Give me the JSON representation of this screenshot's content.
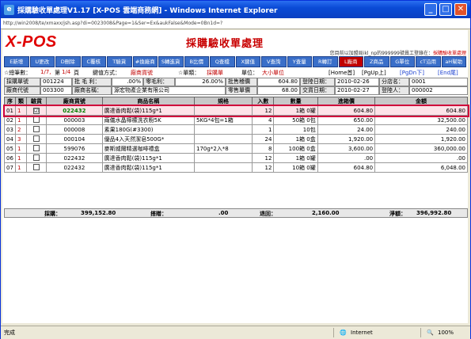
{
  "window": {
    "title": "採購驗收單處理V1.17 [X-POS 雲端商務網] - Windows Internet Explorer",
    "address": "http://win2008/te/xmaxx/jsh.asp?di=0023008&Page=1&Ser=Ex&aukFalse&Mode=0Bn1d=?"
  },
  "app": {
    "logo": "X-POS",
    "page_title": "採購驗收單處理"
  },
  "login": {
    "prefix": "您目前以加盟局ikl_np的999999號員工登錄在：",
    "page": "採購驗收單處理"
  },
  "toolbar": [
    "E新增",
    "U更改",
    "D刪除",
    "C覆核",
    "T驗貨",
    "#換廠商",
    "S轉進貨",
    "B比價",
    "Q查檔",
    "X鍵值",
    "V查詢",
    "Y查量",
    "R轉訂",
    "L廠商",
    "Z商品",
    "G單位",
    "cT沿用",
    "aH幫助"
  ],
  "summary": {
    "total_label": "☆總筆數：",
    "total_value": "1/7,",
    "page_label": "第",
    "page_value": "1/4",
    "page_suffix": "頁",
    "key_label": "鍵值方式：",
    "key_value": "廠商貨號",
    "bill_label": "☆單類：",
    "bill_value": "採購單",
    "unit_label": "單位：",
    "unit_value": "大小單位",
    "nav_home": "[Home首]",
    "nav_pgup": "[PgUp上]",
    "nav_pgdn": "[PgDn下]",
    "nav_end": "[End尾]"
  },
  "form": {
    "row1": {
      "l1": "採購單號",
      "v1": "001224",
      "l2": "批 毛 利：",
      "v2": ".00%",
      "l3": "零毛利：",
      "v3": "26.00%",
      "l4": "批售稽價",
      "v4": "604.80",
      "l5": "登陸日期：",
      "v5": "2010-02-26",
      "l6": "分店名：",
      "v6": "0001"
    },
    "row2": {
      "l1": "廠商代號",
      "v1": "003300",
      "l2": "廠商名稱：",
      "v2": "源宏物產企業有限公司",
      "l4": "零售單價",
      "v4": "68.00",
      "l5": "交貨日期：",
      "v5": "2010-02-27",
      "l6": "登陸人：",
      "v6": "000002"
    }
  },
  "grid": {
    "headers": [
      "序",
      "類",
      "驗貨",
      "廠商貨號",
      "商品名稱",
      "規格",
      "入數",
      "數量",
      "進箱價",
      "金額"
    ],
    "rows": [
      {
        "seq": "01",
        "type": "1",
        "check": "☑",
        "code": "022432",
        "name": "廣達香肉鬆(袋)115g*1",
        "spec": "",
        "pack": "12",
        "qty": "1箱 0罐",
        "price": "604.80",
        "amount": "604.80"
      },
      {
        "seq": "02",
        "type": "1",
        "check": "",
        "code": "000003",
        "name": "兩儀水晶檸檬洗衣粉5K",
        "spec": "5KG*4包=1箱",
        "pack": "4",
        "qty": "50箱 0包",
        "price": "650.00",
        "amount": "32,500.00"
      },
      {
        "seq": "03",
        "type": "2",
        "check": "",
        "code": "000008",
        "name": "素果180G(#3300)",
        "spec": "",
        "pack": "1",
        "qty": "10包",
        "price": "24.00",
        "amount": "240.00"
      },
      {
        "seq": "04",
        "type": "3",
        "check": "",
        "code": "000104",
        "name": "優品4入天然潔皂500G*",
        "spec": "",
        "pack": "24",
        "qty": "1箱 0盒",
        "price": "1,920.00",
        "amount": "1,920.00"
      },
      {
        "seq": "05",
        "type": "1",
        "check": "",
        "code": "599076",
        "name": "麥斯威爾精選咖啡禮盒",
        "spec": "170g*2入*8",
        "pack": "8",
        "qty": "100箱 0盒",
        "price": "3,600.00",
        "amount": "360,000.00"
      },
      {
        "seq": "06",
        "type": "1",
        "check": "",
        "code": "022432",
        "name": "廣達香肉鬆(袋)115g*1",
        "spec": "",
        "pack": "12",
        "qty": "1箱 0罐",
        "price": ".00",
        "amount": ".00"
      },
      {
        "seq": "07",
        "type": "1",
        "check": "",
        "code": "022432",
        "name": "廣達香肉鬆(袋)115g*1",
        "spec": "",
        "pack": "12",
        "qty": "10箱 0罐",
        "price": "604.80",
        "amount": "6,048.00"
      }
    ]
  },
  "totals": {
    "purchase_label": "採購：",
    "purchase_value": "399,152.80",
    "discount_label": "搭贈：",
    "discount_value": ".00",
    "return_label": "退回：",
    "return_value": "2,160.00",
    "net_label": "淨額：",
    "net_value": "396,992.80"
  },
  "statusbar": {
    "status": "完成",
    "zone": "Internet",
    "zoom": "100%"
  }
}
